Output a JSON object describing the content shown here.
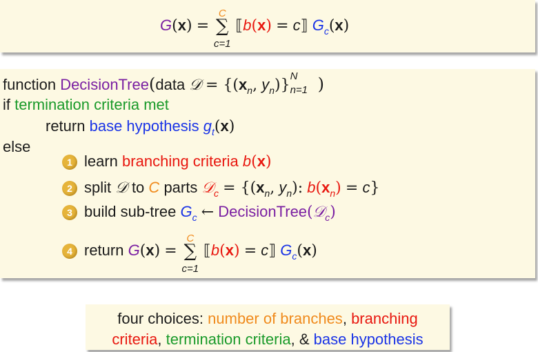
{
  "header_formula": {
    "lhs_G": "G",
    "lhs_x": "x",
    "eq": "=",
    "sum_top": "C",
    "sum_bottom": "c=1",
    "b": "b",
    "x": "x",
    "c": "c",
    "Gc_G": "G",
    "Gc_c": "c"
  },
  "algo": {
    "function_kw": "function",
    "func_name": "DecisionTree",
    "data_label": "data",
    "data_set": "𝒟",
    "xn": "x",
    "n_sub": "n",
    "yn": "y",
    "sup_N": "N",
    "sub_n1": "n=1",
    "if_kw": "if",
    "termination": "termination criteria met",
    "return_kw": "return",
    "base_hyp": "base hypothesis",
    "g": "g",
    "t_sub": "t",
    "else_kw": "else",
    "step1_num": "1",
    "step1_learn": "learn",
    "step1_branch": "branching criteria",
    "step2_num": "2",
    "step2_split": "split",
    "step2_to": "to",
    "step2_C": "C",
    "step2_parts": "parts",
    "step3_num": "3",
    "step3_build": "build sub-tree",
    "step3_arrow": "←",
    "step4_num": "4",
    "step4_return": "return"
  },
  "note": {
    "lead": "four choices:",
    "choice1": "number of branches",
    "choice2a": "branching",
    "choice2b": "criteria",
    "choice3": "termination criteria",
    "amp": "&",
    "choice4": "base hypothesis"
  }
}
